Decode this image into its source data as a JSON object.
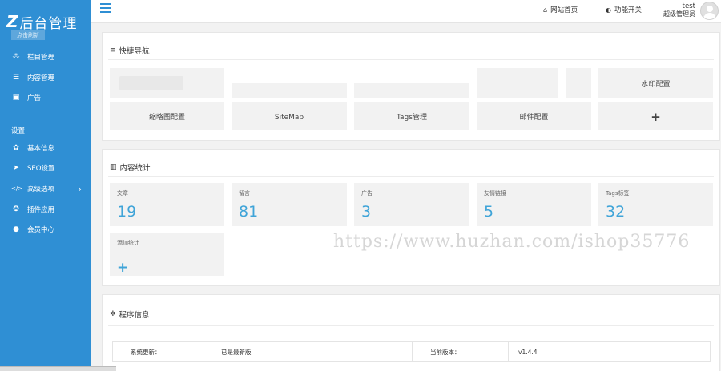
{
  "logo": {
    "mark": "Z",
    "title": "后台管理",
    "subtitle": "点击刷新"
  },
  "sidebar": {
    "items_top": [
      {
        "label": "栏目管理",
        "icon": "sitemap-icon",
        "glyph": "⁂"
      },
      {
        "label": "内容管理",
        "icon": "list-icon",
        "glyph": "☰"
      },
      {
        "label": "广告",
        "icon": "image-icon",
        "glyph": "▣"
      }
    ],
    "section_label": "设置",
    "items_bottom": [
      {
        "label": "基本信息",
        "icon": "gear-icon",
        "glyph": "✿"
      },
      {
        "label": "SEO设置",
        "icon": "send-icon",
        "glyph": "➤"
      },
      {
        "label": "高级选项",
        "icon": "code-icon",
        "glyph": "</>",
        "arrow": "›"
      },
      {
        "label": "插件应用",
        "icon": "plugin-icon",
        "glyph": "✪"
      },
      {
        "label": "会员中心",
        "icon": "user-icon",
        "glyph": "●"
      }
    ]
  },
  "topbar": {
    "home_label": "网站首页",
    "home_icon": "⌂",
    "toggle_label": "功能开关",
    "toggle_icon": "◐",
    "user_name": "test",
    "user_role": "超级管理员"
  },
  "quick_nav": {
    "title": "快捷导航",
    "title_icon": "≡",
    "tiles_row1": [
      "",
      "",
      "",
      "",
      "",
      "水印配置"
    ],
    "tiles_row2": [
      "缩略图配置",
      "SiteMap",
      "Tags管理",
      "邮件配置"
    ],
    "add_symbol": "+"
  },
  "content_stats": {
    "title": "内容统计",
    "title_icon": "▥",
    "stats": [
      {
        "label": "文章",
        "value": "19"
      },
      {
        "label": "留言",
        "value": "81"
      },
      {
        "label": "广告",
        "value": "3"
      },
      {
        "label": "友情链接",
        "value": "5"
      },
      {
        "label": "Tags标签",
        "value": "32"
      }
    ],
    "add_label": "添加统计",
    "add_symbol": "+"
  },
  "watermark": "https://www.huzhan.com/ishop35776",
  "program_info": {
    "title": "程序信息",
    "title_icon": "✲",
    "rows": [
      {
        "k1": "系统更新：",
        "v1": "已是最新版",
        "k2": "当前版本：",
        "v2": "v1.4.4"
      }
    ]
  },
  "colors": {
    "sidebar": "#2f8fd4",
    "accent": "#3fa4d8",
    "tile": "#f2f2f2"
  }
}
